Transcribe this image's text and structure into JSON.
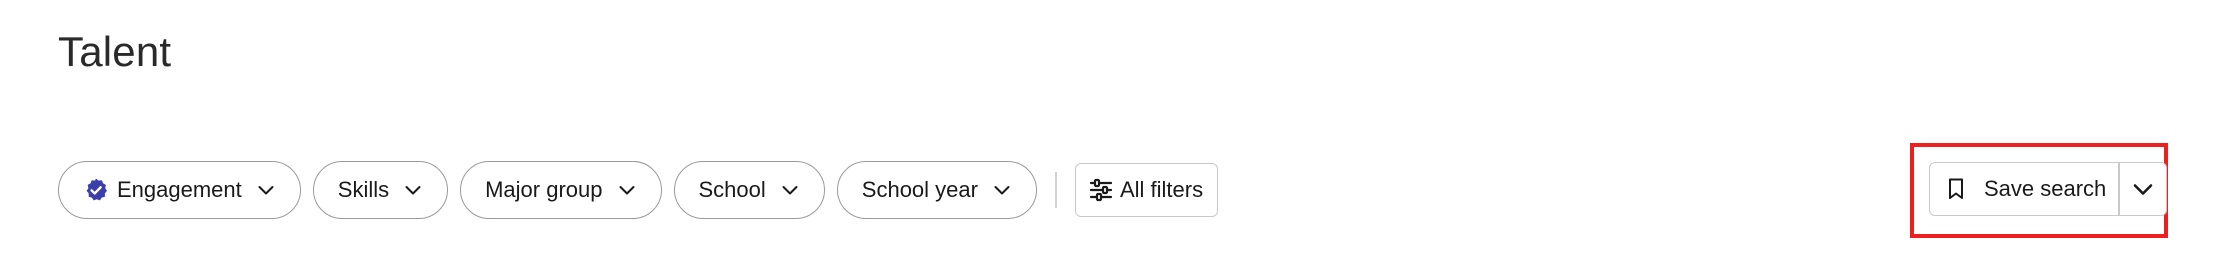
{
  "page": {
    "title": "Talent"
  },
  "filters": {
    "items": [
      {
        "label": "Engagement",
        "icon": "verified-badge-icon"
      },
      {
        "label": "Skills"
      },
      {
        "label": "Major group"
      },
      {
        "label": "School"
      },
      {
        "label": "School year"
      }
    ],
    "all_filters_label": "All filters",
    "all_filters_icon": "sliders-icon"
  },
  "actions": {
    "save_search_label": "Save search",
    "save_search_icon": "bookmark-icon",
    "menu_icon": "chevron-down-icon"
  },
  "colors": {
    "badge": "#3b3fa8",
    "highlight": "#ee1f1f",
    "pill_border": "#9a9a9a"
  }
}
